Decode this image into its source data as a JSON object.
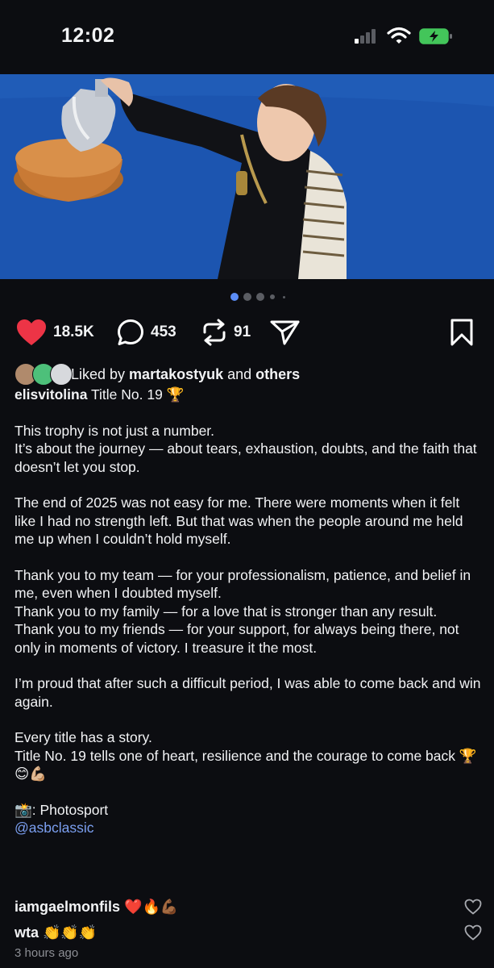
{
  "status_bar": {
    "time": "12:02"
  },
  "post": {
    "carousel_count": 5,
    "carousel_active": 0,
    "likes": "18.5K",
    "comments": "453",
    "reposts": "91",
    "liked_by_prefix": "Liked by ",
    "liked_by_user": "martakostyuk",
    "liked_by_and": " and ",
    "liked_by_others": "others",
    "author": "elisvitolina",
    "title_text": " Title No. 19 🏆",
    "body": [
      "This trophy is not just a number.",
      "It’s about the journey — about tears, exhaustion, doubts, and the faith that doesn’t let you stop.",
      "",
      "The end of 2025 was not easy for me. There were moments when it felt like I had no strength left. But that was when the people around me held me up when I couldn’t hold myself.",
      "",
      "Thank you to my team — for your professionalism, patience, and belief in me, even when I doubted myself.",
      "Thank you to my family — for a love that is stronger than any result.",
      "Thank you to my friends — for your support, for always being there, not only in moments of victory. I treasure it the most.",
      "",
      "I’m proud that after such a difficult period, I was able to come back and win again.",
      "",
      "Every title has a story.",
      "Title No. 19 tells one of heart, resilience and the courage to come back 🏆😊💪🏼",
      "",
      "📸: Photosport"
    ],
    "mention": "@asbclassic",
    "time_ago": "3 hours ago"
  },
  "comments": [
    {
      "user": "iamgaelmonfils",
      "text": " ❤️🔥💪🏾"
    },
    {
      "user": "wta",
      "text": " 👏👏👏"
    }
  ],
  "colors": {
    "like": "#ed3446",
    "link": "#7b9ff0",
    "dot_active": "#5b8df7",
    "background": "#0c0d11"
  }
}
